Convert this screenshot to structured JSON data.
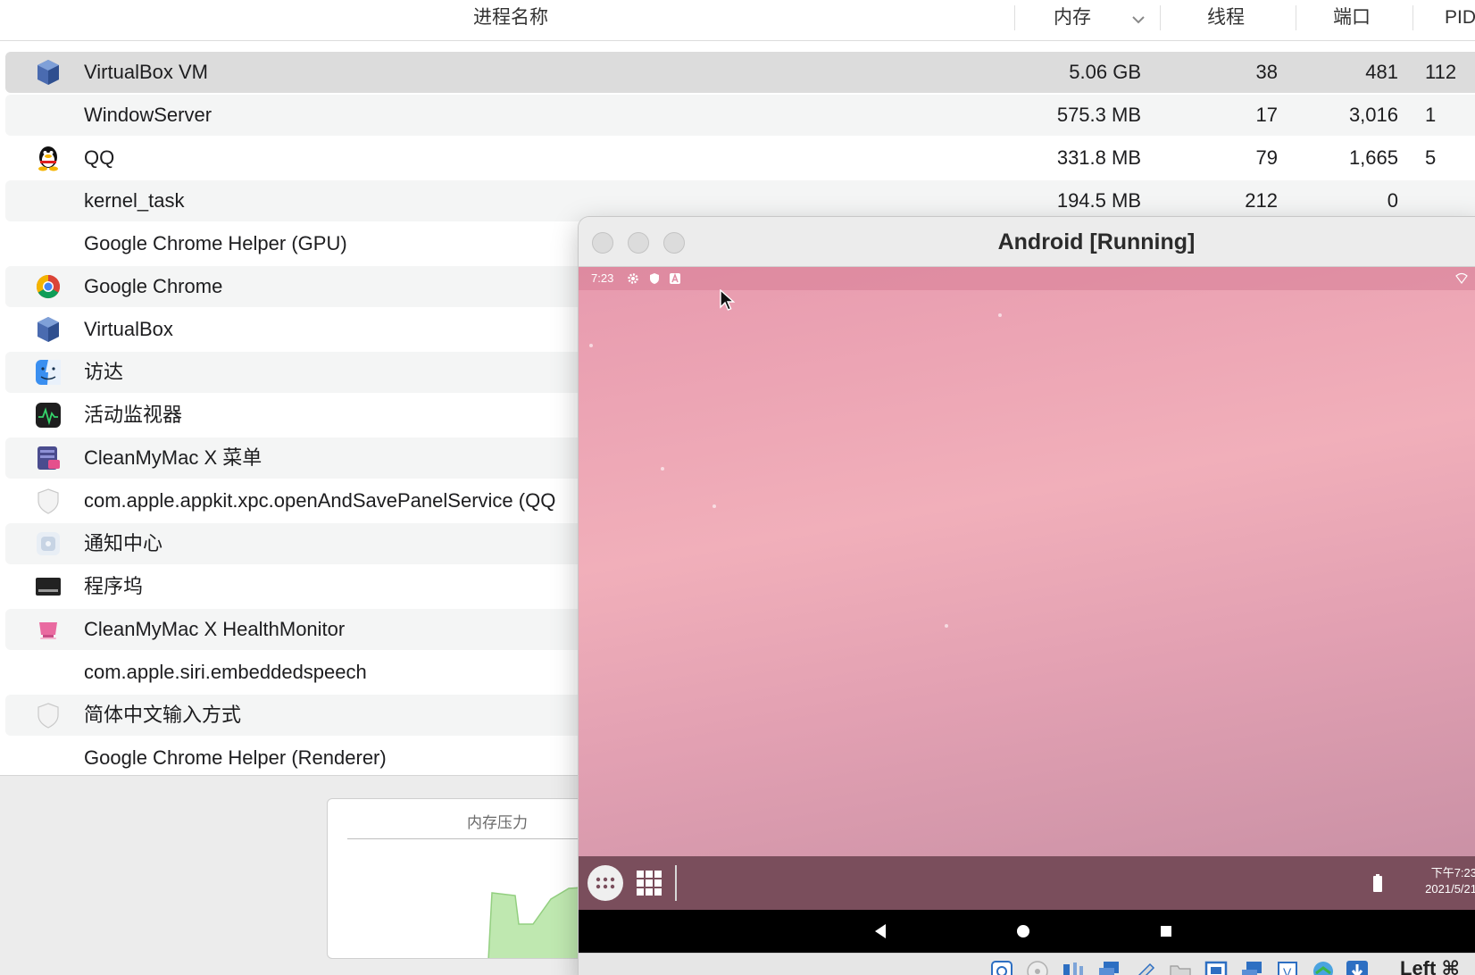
{
  "columns": {
    "name": "进程名称",
    "memory": "内存",
    "threads": "线程",
    "ports": "端口",
    "pid": "PID"
  },
  "processes": [
    {
      "name": "VirtualBox VM",
      "icon": "virtualbox-icon",
      "memory": "5.06 GB",
      "threads": "38",
      "ports": "481",
      "pid": "112"
    },
    {
      "name": "WindowServer",
      "icon": "",
      "memory": "575.3 MB",
      "threads": "17",
      "ports": "3,016",
      "pid": "1"
    },
    {
      "name": "QQ",
      "icon": "qq-penguin-icon",
      "memory": "331.8 MB",
      "threads": "79",
      "ports": "1,665",
      "pid": "5"
    },
    {
      "name": "kernel_task",
      "icon": "",
      "memory": "194.5 MB",
      "threads": "212",
      "ports": "0",
      "pid": ""
    },
    {
      "name": "Google Chrome Helper (GPU)",
      "icon": ""
    },
    {
      "name": "Google Chrome",
      "icon": "chrome-icon"
    },
    {
      "name": "VirtualBox",
      "icon": "virtualbox-icon"
    },
    {
      "name": "访达",
      "icon": "finder-icon"
    },
    {
      "name": "活动监视器",
      "icon": "activity-monitor-icon"
    },
    {
      "name": "CleanMyMac X 菜单",
      "icon": "cleanmymac-menu-icon"
    },
    {
      "name": "com.apple.appkit.xpc.openAndSavePanelService (QQ",
      "icon": "shield-icon"
    },
    {
      "name": "通知中心",
      "icon": "notification-center-icon"
    },
    {
      "name": "程序坞",
      "icon": "dock-icon"
    },
    {
      "name": "CleanMyMac X HealthMonitor",
      "icon": "cleanmymac-healthmonitor-icon"
    },
    {
      "name": "com.apple.siri.embeddedspeech",
      "icon": ""
    },
    {
      "name": "简体中文输入方式",
      "icon": "shield-icon"
    },
    {
      "name": "Google Chrome Helper (Renderer)",
      "icon": ""
    }
  ],
  "memory_pressure": {
    "title": "内存压力",
    "color": "#9fd98a"
  },
  "vbox_window": {
    "title": "Android [Running]"
  },
  "android": {
    "status_time": "7:23",
    "taskbar_time": "下午7:23",
    "taskbar_date": "2021/5/21"
  },
  "vbox_statusbar": {
    "host_key": "Left ⌘"
  },
  "colors": {
    "selected_row": "#dcdcdc",
    "alt_row": "#f4f5f5",
    "android_taskbar": "#7a4e5c",
    "wallpaper_top": "#e79aae",
    "wallpaper_bottom": "#c58ea3"
  }
}
